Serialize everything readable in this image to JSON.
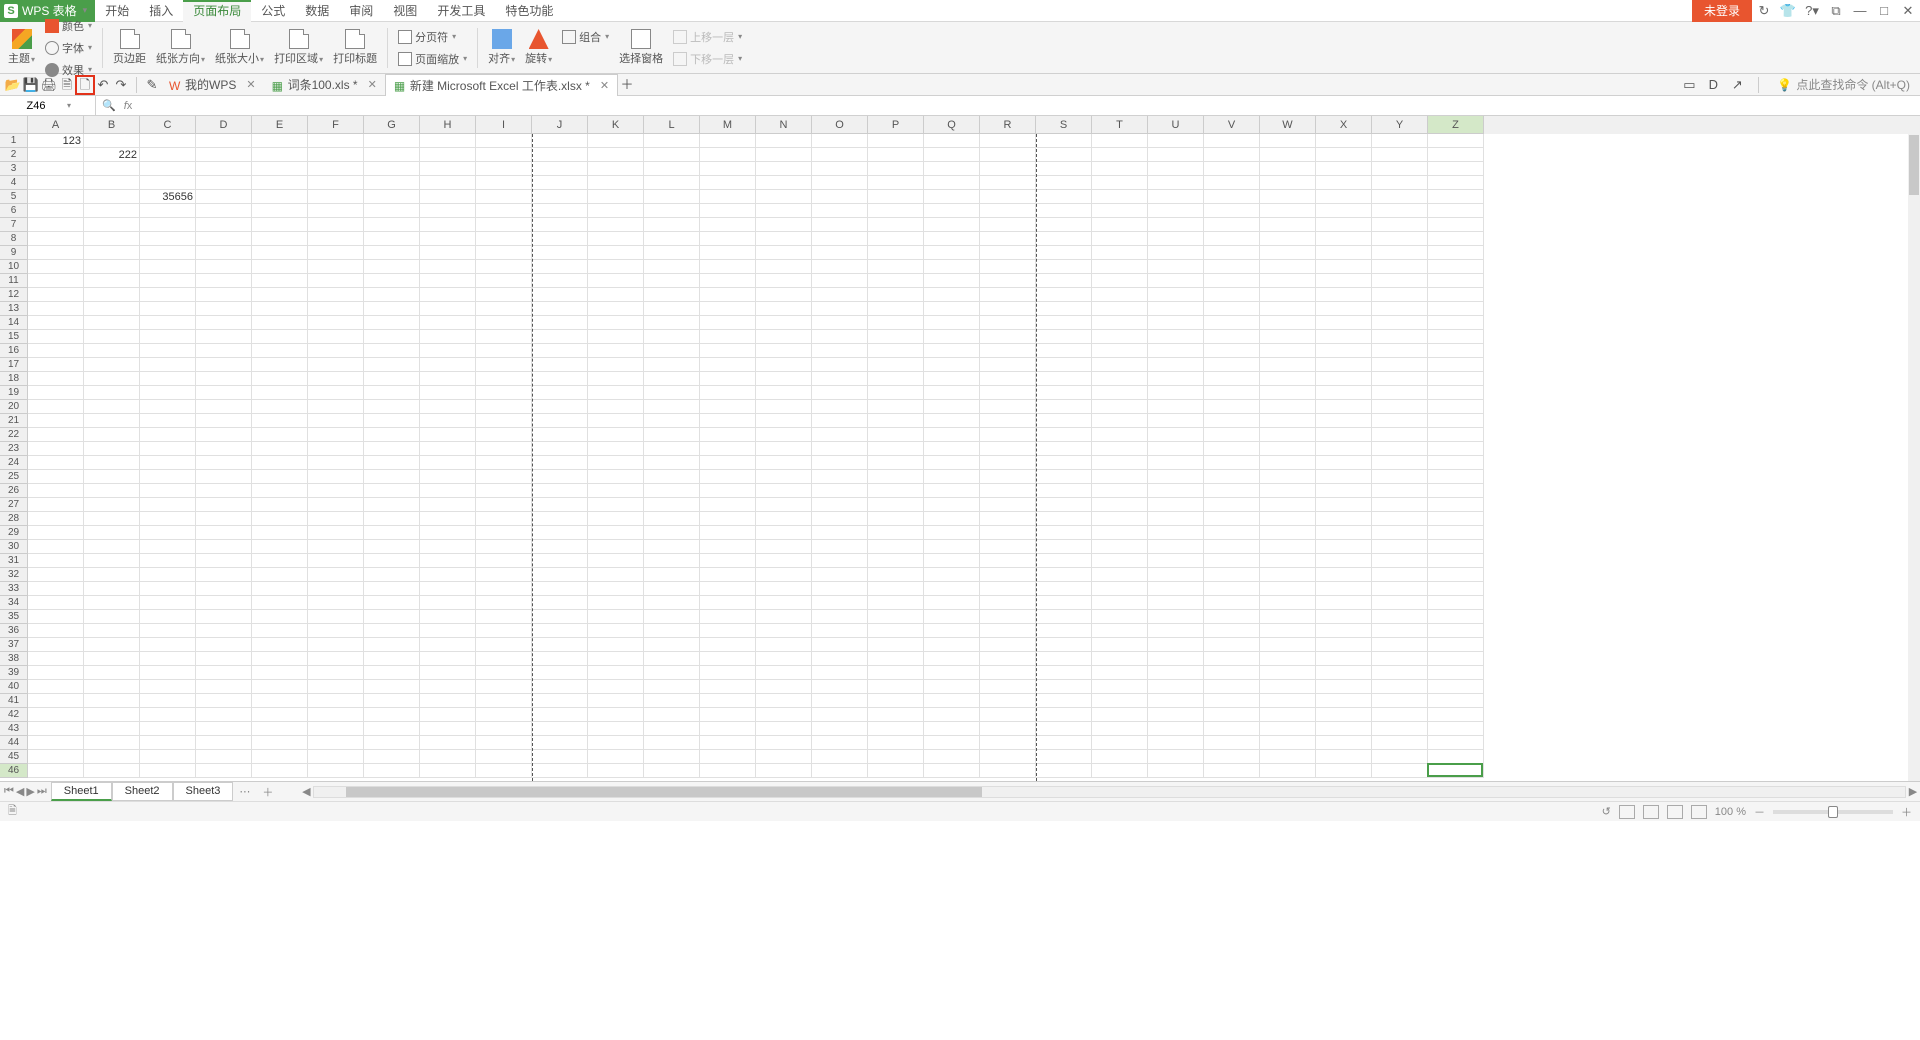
{
  "app": {
    "name": "WPS 表格"
  },
  "menu": [
    "开始",
    "插入",
    "页面布局",
    "公式",
    "数据",
    "审阅",
    "视图",
    "开发工具",
    "特色功能"
  ],
  "menu_active": 2,
  "title_right": {
    "login": "未登录"
  },
  "ribbon": {
    "theme": "主题",
    "font": "字体",
    "effect": "效果",
    "color": "颜色",
    "margin": "页边距",
    "orient": "纸张方向",
    "size": "纸张大小",
    "area": "打印区域",
    "titles": "打印标题",
    "breaks": "分页符",
    "scale": "页面缩放",
    "align": "对齐",
    "rotate": "旋转",
    "group": "组合",
    "pane": "选择窗格",
    "front": "上移一层",
    "back": "下移一层"
  },
  "doc_tabs": [
    {
      "label": "我的WPS",
      "active": false
    },
    {
      "label": "词条100.xls *",
      "active": false
    },
    {
      "label": "新建 Microsoft Excel 工作表.xlsx *",
      "active": true
    }
  ],
  "find_hint": "点此查找命令 (Alt+Q)",
  "name_box": "Z46",
  "columns": [
    "A",
    "B",
    "C",
    "D",
    "E",
    "F",
    "G",
    "H",
    "I",
    "J",
    "K",
    "L",
    "M",
    "N",
    "O",
    "P",
    "Q",
    "R",
    "S",
    "T",
    "U",
    "V",
    "W",
    "X",
    "Y",
    "Z"
  ],
  "row_count": 46,
  "cells": {
    "A1": "123",
    "B2": "222",
    "C5": "35656"
  },
  "selected": {
    "col": 25,
    "row": 45
  },
  "page_breaks_after_col": [
    8,
    17
  ],
  "sheets": [
    "Sheet1",
    "Sheet2",
    "Sheet3"
  ],
  "sheet_active": 0,
  "status": {
    "zoom": "100 %"
  }
}
